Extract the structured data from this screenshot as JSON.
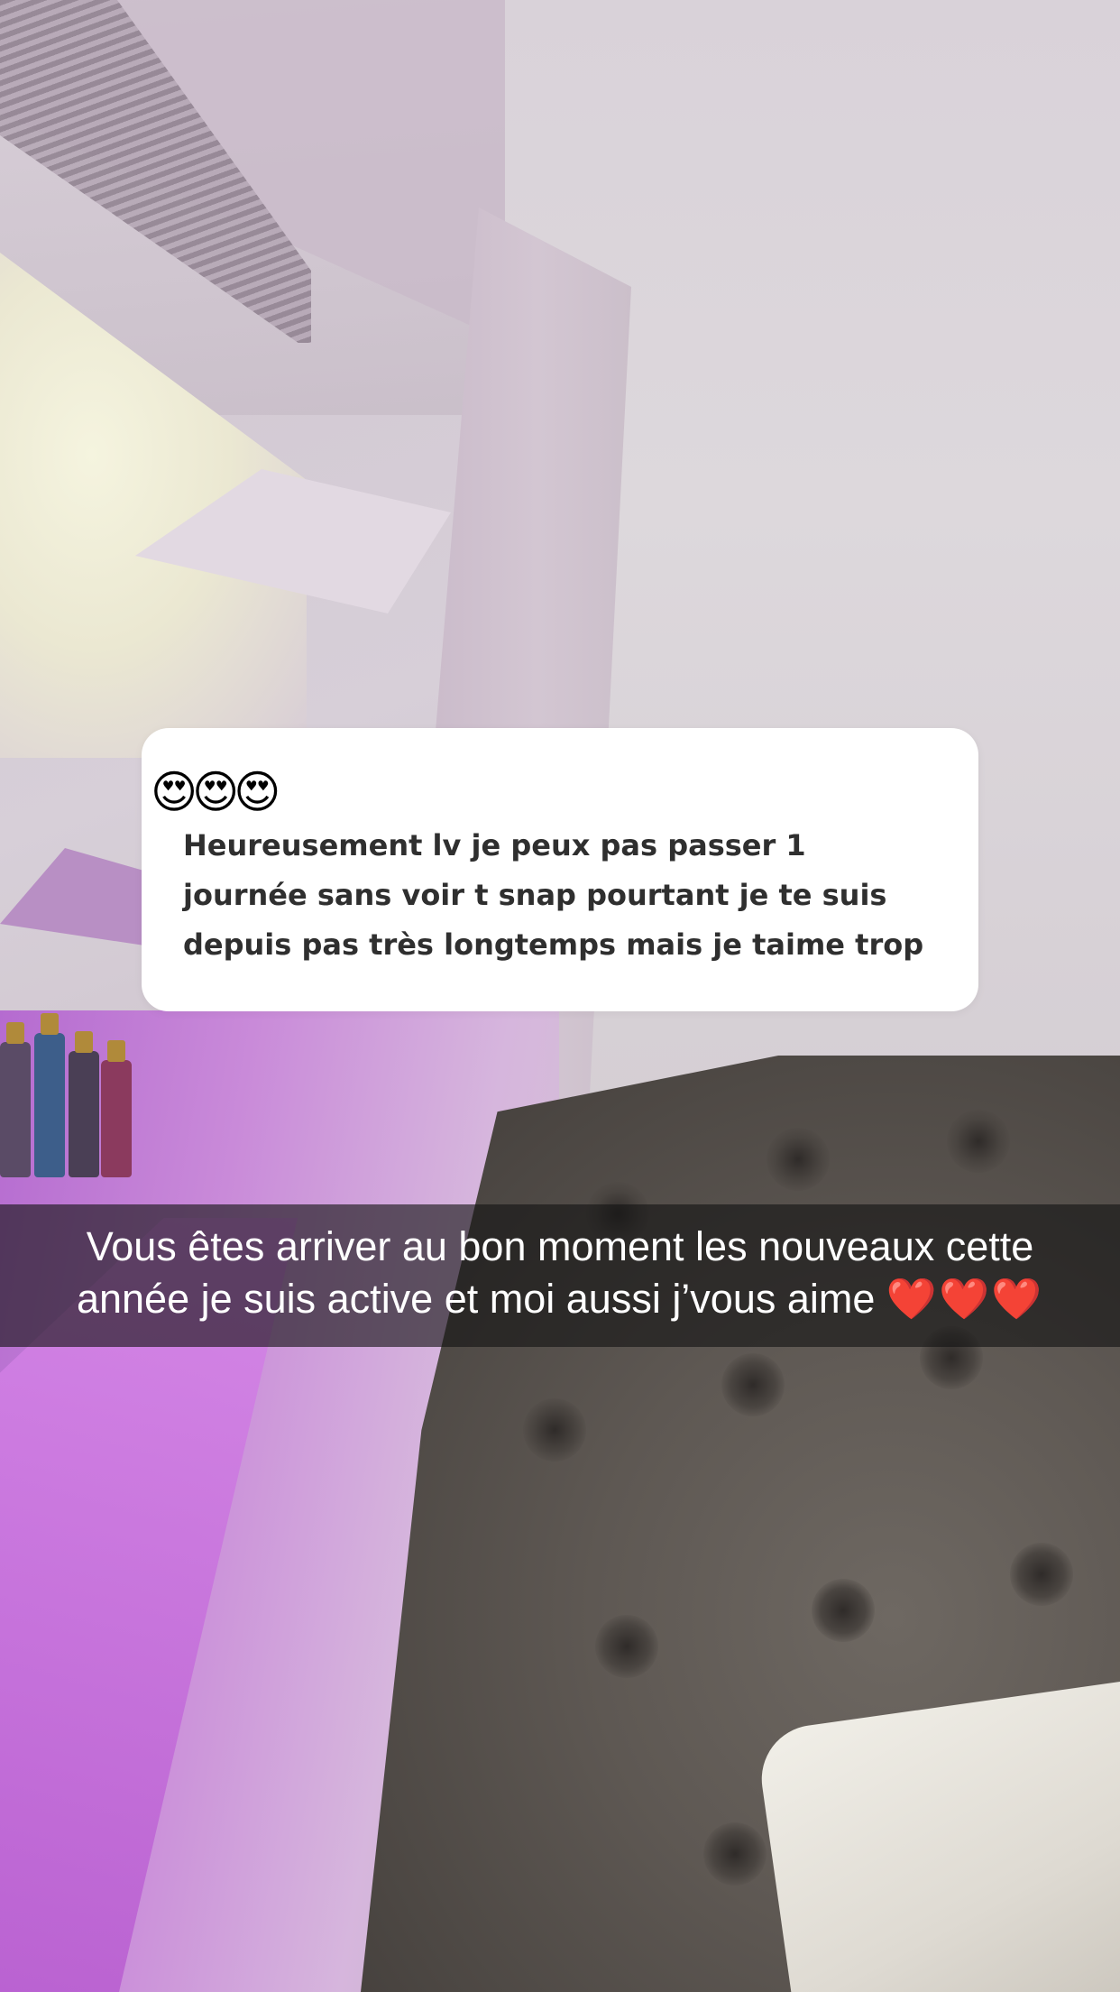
{
  "question_card": {
    "emoji": "😍😍😍",
    "text": "Heureusement lv je peux pas passer 1\njournée sans voir t snap pourtant je te suis\ndepuis pas très longtemps mais je taime trop"
  },
  "caption": {
    "line1": "Vous êtes arriver au bon moment les nouveaux cette",
    "line2": "année je suis active et moi aussi j’vous aime",
    "hearts": "❤️❤️❤️"
  },
  "colors": {
    "card_background": "#ffffff",
    "card_text": "#2f2f2f",
    "caption_bar": "rgba(20,20,20,0.62)",
    "caption_text": "#ffffff",
    "heart": "#e0161c"
  }
}
